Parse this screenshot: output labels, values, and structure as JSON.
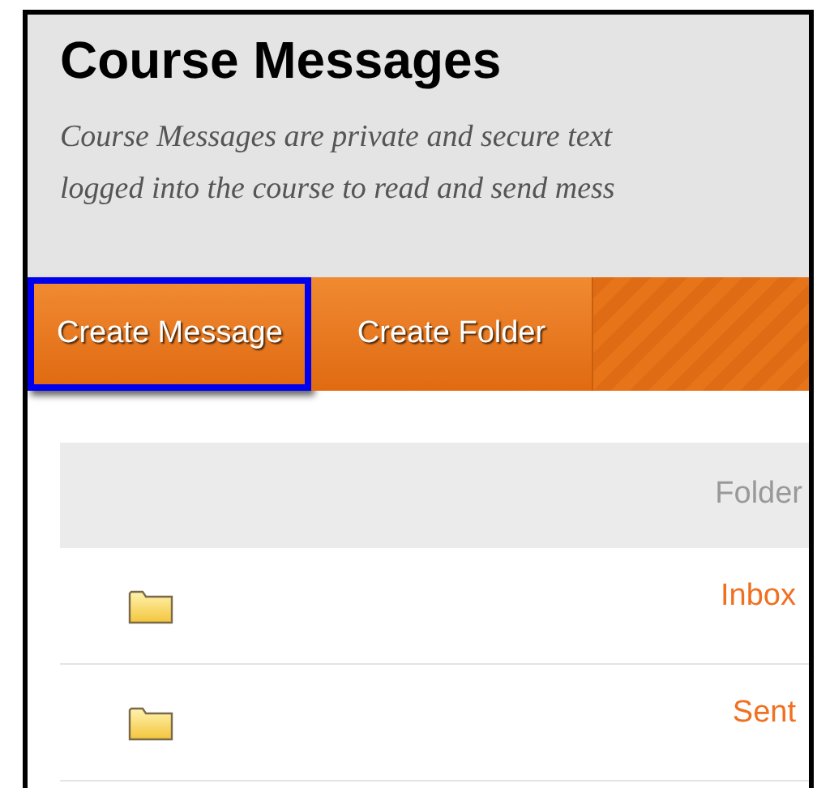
{
  "page": {
    "title": "Course Messages",
    "description_lines": [
      "Course Messages are private and secure text",
      "logged into the course to read and send mess"
    ]
  },
  "action_bar": {
    "buttons": [
      {
        "label": "Create Message",
        "highlighted": true
      },
      {
        "label": "Create Folder",
        "highlighted": false
      }
    ]
  },
  "table": {
    "columns": [
      "Folder"
    ],
    "rows": [
      {
        "folder": "Inbox"
      },
      {
        "folder": "Sent"
      }
    ]
  }
}
